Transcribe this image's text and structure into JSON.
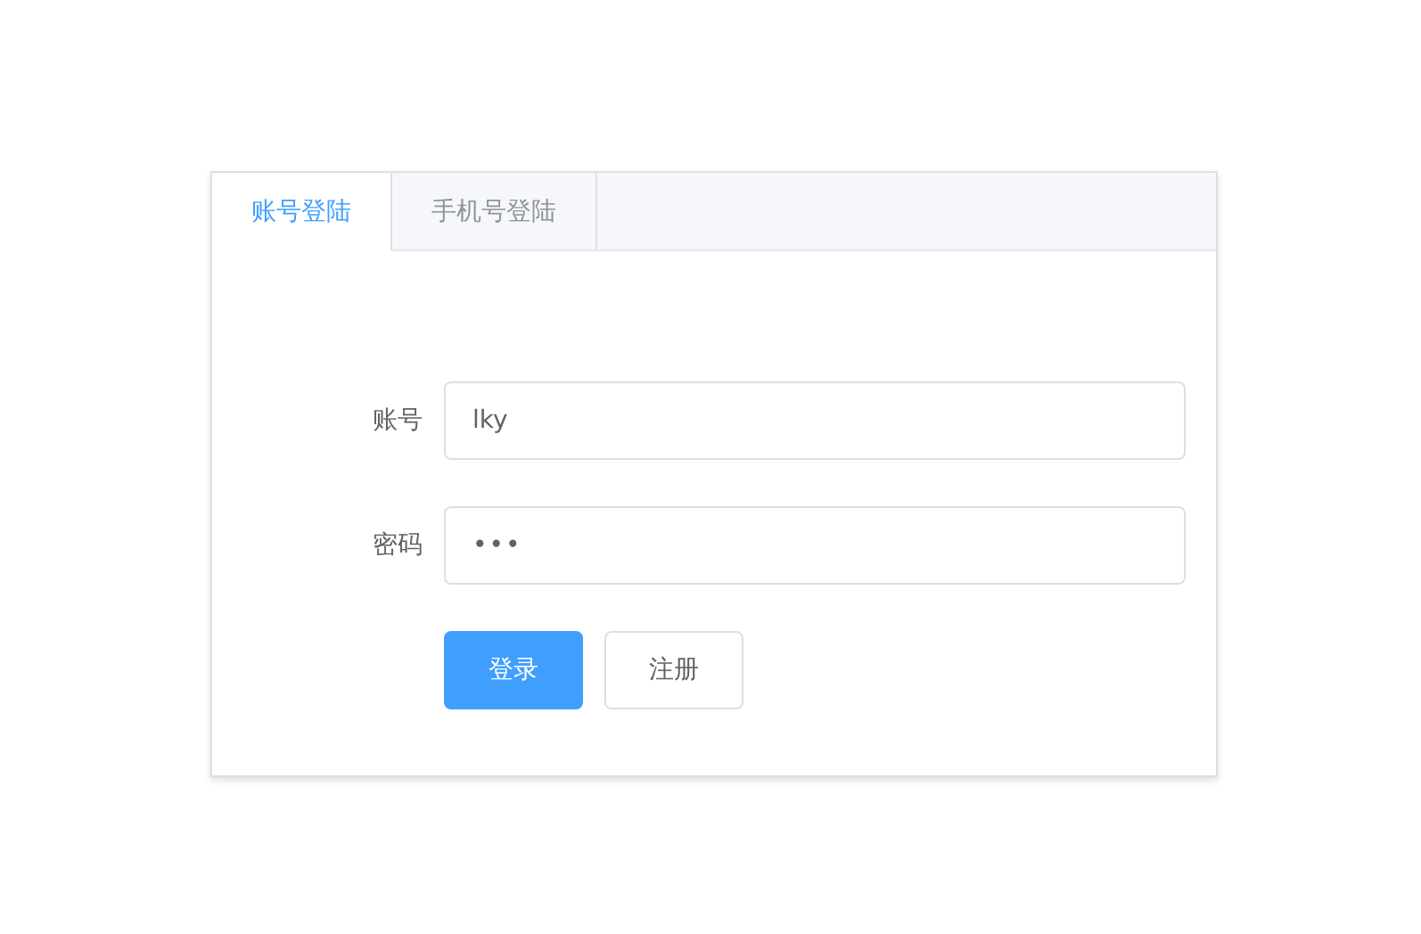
{
  "tabs": [
    {
      "label": "账号登陆",
      "selected": true
    },
    {
      "label": "手机号登陆",
      "selected": false
    }
  ],
  "fields": [
    {
      "label": "账号",
      "value": "lky",
      "kind": "text"
    },
    {
      "label": "密码",
      "value": "•••",
      "kind": "password"
    }
  ],
  "buttons": [
    {
      "label": "登录",
      "kind": "primary"
    },
    {
      "label": "注册",
      "kind": "default"
    }
  ]
}
